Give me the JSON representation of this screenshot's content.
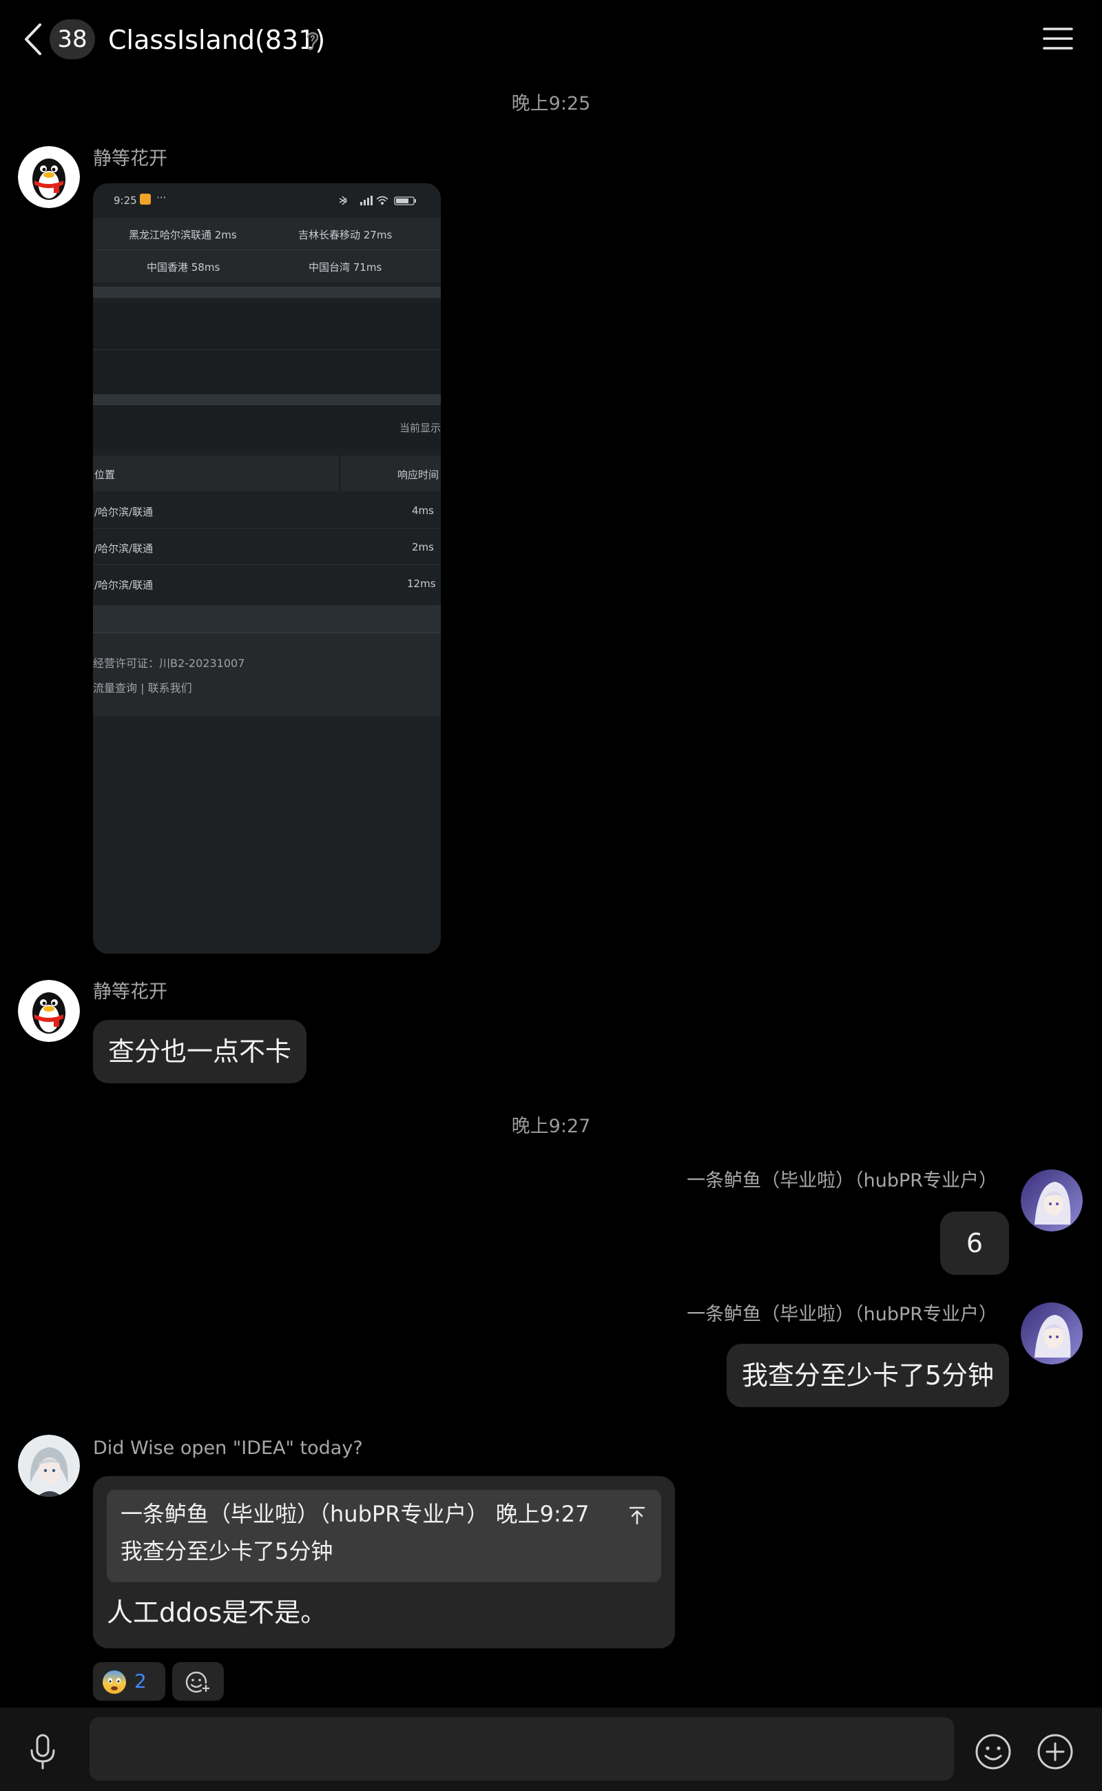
{
  "header": {
    "unread_count": "38",
    "title": "ClassIsland(831)"
  },
  "messages": {
    "time_1": "晚上9:25",
    "time_2": "晚上9:27",
    "m1_sender": "静等花开",
    "m2_sender": "静等花开",
    "m2_text": "查分也一点不卡",
    "m3_sender": "一条鲈鱼（毕业啦）（hubPR专业户）",
    "m3_text": "6",
    "m4_sender": "一条鲈鱼（毕业啦）（hubPR专业户）",
    "m4_text": "我查分至少卡了5分钟",
    "m5_sender": "Did Wise open \"IDEA\" today?",
    "m5_quote_head": "一条鲈鱼（毕业啦）（hubPR专业户） 晚上9:27",
    "m5_quote_body": "我查分至少卡了5分钟",
    "m5_text": "人工ddos是不是。",
    "m5_reaction_count": "2"
  },
  "screenshot": {
    "status_time": "9:25",
    "row1_a": "黑龙江哈尔滨联通 2ms",
    "row1_b": "吉林长春移动 27ms",
    "row2_a": "中国香港 58ms",
    "row2_b": "中国台湾 71ms",
    "current_label": "当前显示",
    "col_location": "位置",
    "col_response": "响应时间",
    "rows": [
      {
        "loc": "/哈尔滨/联通",
        "ms": "4ms"
      },
      {
        "loc": "/哈尔滨/联通",
        "ms": "2ms"
      },
      {
        "loc": "/哈尔滨/联通",
        "ms": "12ms"
      }
    ],
    "license": "经营许可证：川B2-20231007",
    "footer_links": "流量查询  |  联系我们"
  },
  "colors": {
    "background": "#000000",
    "bubble": "#262626",
    "accent_blue": "#3d8bff"
  }
}
